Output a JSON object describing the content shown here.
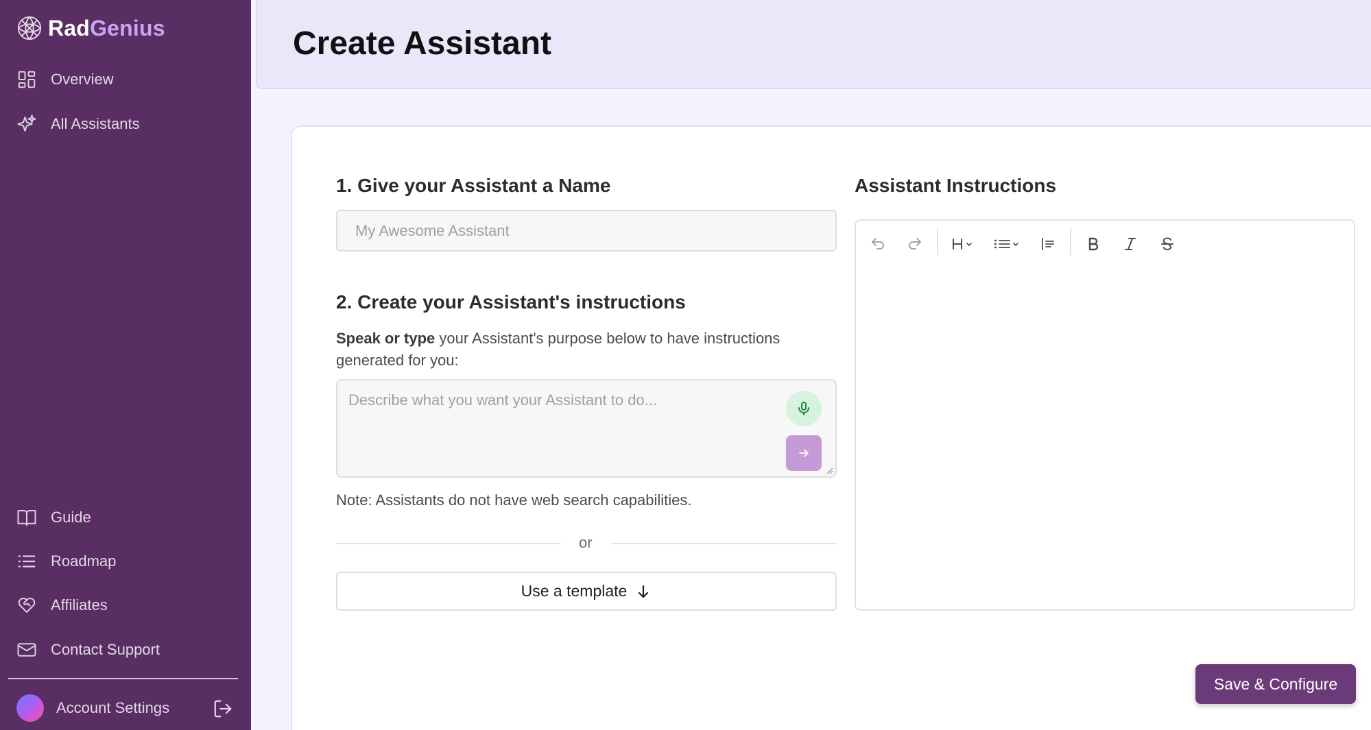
{
  "brand": {
    "part1": "Rad",
    "part2": "Genius"
  },
  "sidebar": {
    "top_items": [
      {
        "label": "Overview",
        "icon": "dashboard-grid-icon"
      },
      {
        "label": "All Assistants",
        "icon": "sparkles-icon"
      }
    ],
    "bottom_items": [
      {
        "label": "Guide",
        "icon": "open-book-icon"
      },
      {
        "label": "Roadmap",
        "icon": "list-icon"
      },
      {
        "label": "Affiliates",
        "icon": "heart-handshake-icon"
      },
      {
        "label": "Contact Support",
        "icon": "mail-icon"
      }
    ],
    "account": {
      "label": "Account Settings",
      "logout_icon": "logout-icon"
    }
  },
  "header": {
    "title": "Create Assistant"
  },
  "form": {
    "step1_title": "1. Give your Assistant a Name",
    "name_placeholder": "My Awesome Assistant",
    "name_value": "",
    "step2_title": "2. Create your Assistant's instructions",
    "desc_bold": "Speak or type",
    "desc_rest": " your Assistant's purpose below to have instructions generated for you:",
    "prompt_placeholder": "Describe what you want your Assistant to do...",
    "prompt_value": "",
    "note": "Note: Assistants do not have web search capabilities.",
    "or_text": "or",
    "template_button": "Use a template"
  },
  "editor": {
    "title": "Assistant Instructions",
    "toolbar": [
      "undo-icon",
      "redo-icon",
      "heading-dropdown-icon",
      "bullet-list-dropdown-icon",
      "blockquote-icon",
      "bold-icon",
      "italic-icon",
      "strikethrough-icon"
    ],
    "content": ""
  },
  "actions": {
    "save_label": "Save & Configure"
  },
  "colors": {
    "sidebar_bg": "#582e63",
    "header_bg": "#ebe7fb",
    "accent": "#6b3a78",
    "brand_highlight": "#c9a5f0",
    "mic_bg": "#d6f3df",
    "send_bg": "#c49bd6"
  }
}
